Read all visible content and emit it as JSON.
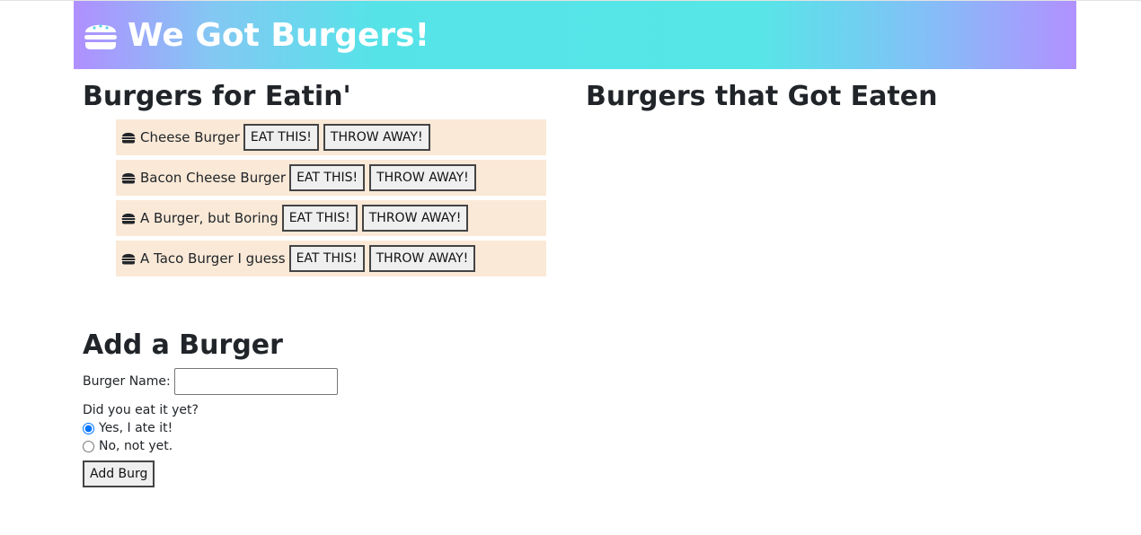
{
  "header": {
    "title": "We Got Burgers!",
    "icon": "burger-icon"
  },
  "uneaten": {
    "heading": "Burgers for Eatin'",
    "eat_label": "EAT THIS!",
    "throw_label": "THROW AWAY!",
    "items": [
      {
        "name": "Cheese Burger"
      },
      {
        "name": "Bacon Cheese Burger"
      },
      {
        "name": "A Burger, but Boring"
      },
      {
        "name": "A Taco Burger I guess"
      }
    ]
  },
  "eaten": {
    "heading": "Burgers that Got Eaten"
  },
  "form": {
    "heading": "Add a Burger",
    "name_label": "Burger Name:",
    "name_value": "",
    "question": "Did you eat it yet?",
    "option_yes": "Yes, I ate it!",
    "option_no": "No, not yet.",
    "selected": "yes",
    "submit_label": "Add Burg"
  },
  "colors": {
    "item_bg": "#fae9d7",
    "header_gradient": [
      "#b08fff",
      "#56e3e8",
      "#b191ff"
    ]
  }
}
